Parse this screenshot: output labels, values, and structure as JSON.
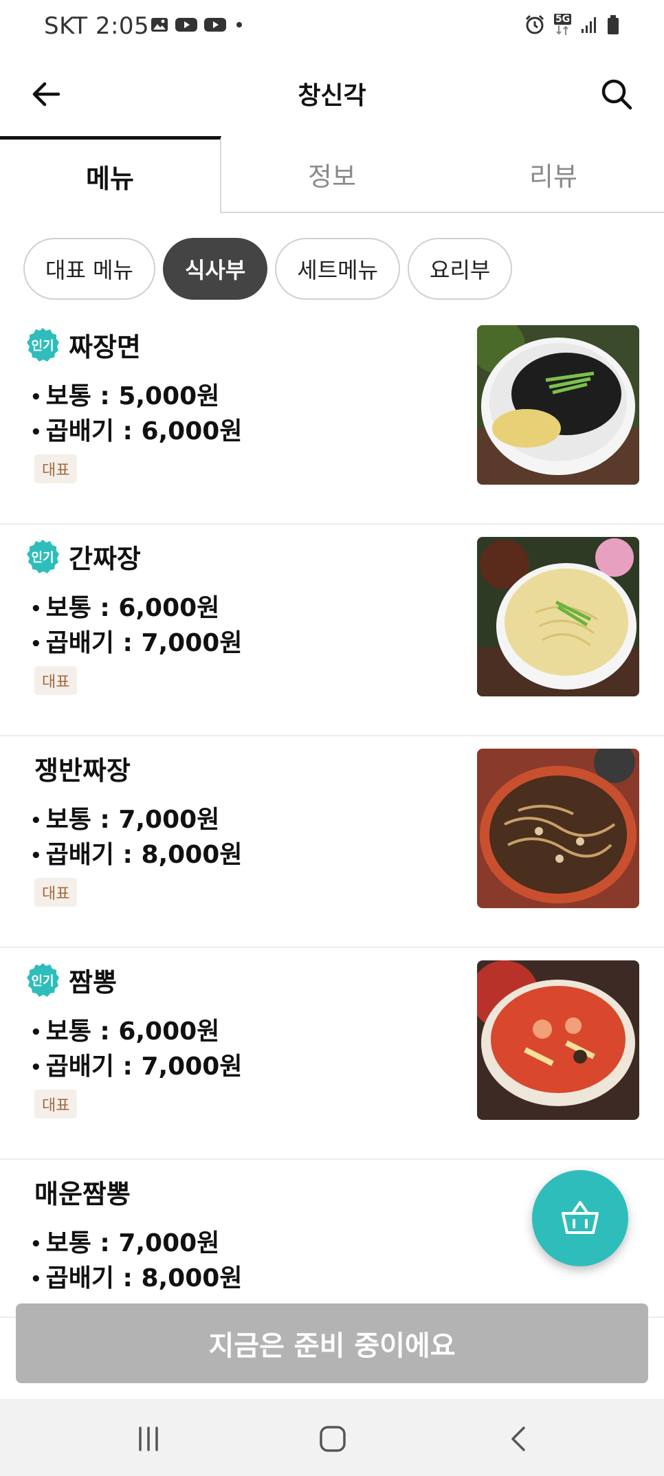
{
  "status_bar": {
    "time": "SKT 2:05",
    "network": "5G",
    "left_icons": [
      "gallery-icon",
      "youtube-icon",
      "youtube-icon",
      "dot-icon"
    ],
    "right_icons": [
      "alarm-icon",
      "5g-icon",
      "signal-icon",
      "battery-icon"
    ]
  },
  "header": {
    "title": "창신각",
    "back_icon": "arrow-left-icon",
    "search_icon": "search-icon"
  },
  "tabs": [
    {
      "label": "메뉴",
      "active": true
    },
    {
      "label": "정보",
      "active": false
    },
    {
      "label": "리뷰",
      "active": false
    }
  ],
  "categories": [
    {
      "label": "대표 메뉴",
      "active": false
    },
    {
      "label": "식사부",
      "active": true
    },
    {
      "label": "세트메뉴",
      "active": false
    },
    {
      "label": "요리부",
      "active": false
    }
  ],
  "menu": [
    {
      "name": "짜장면",
      "popular": true,
      "badge_text": "인기",
      "prices": [
        "보통 : 5,000원",
        "곱배기 : 6,000원"
      ],
      "tag": "대표"
    },
    {
      "name": "간짜장",
      "popular": true,
      "badge_text": "인기",
      "prices": [
        "보통 : 6,000원",
        "곱배기 : 7,000원"
      ],
      "tag": "대표"
    },
    {
      "name": "쟁반짜장",
      "popular": false,
      "prices": [
        "보통 : 7,000원",
        "곱배기 : 8,000원"
      ],
      "tag": "대표"
    },
    {
      "name": "짬뽕",
      "popular": true,
      "badge_text": "인기",
      "prices": [
        "보통 : 6,000원",
        "곱배기 : 7,000원"
      ],
      "tag": "대표"
    },
    {
      "name": "매운짬뽕",
      "popular": false,
      "prices": [
        "보통 : 7,000원",
        "곱배기 : 8,000원"
      ]
    }
  ],
  "cart": {
    "icon": "shopping-basket-icon"
  },
  "prep_banner": "지금은 준비 중이에요",
  "colors": {
    "accent": "#2ebdbb",
    "active_chip": "#444444",
    "tag_bg": "#f4efe9",
    "tag_text": "#a4673f",
    "disabled_bar": "#b3b3b3"
  }
}
